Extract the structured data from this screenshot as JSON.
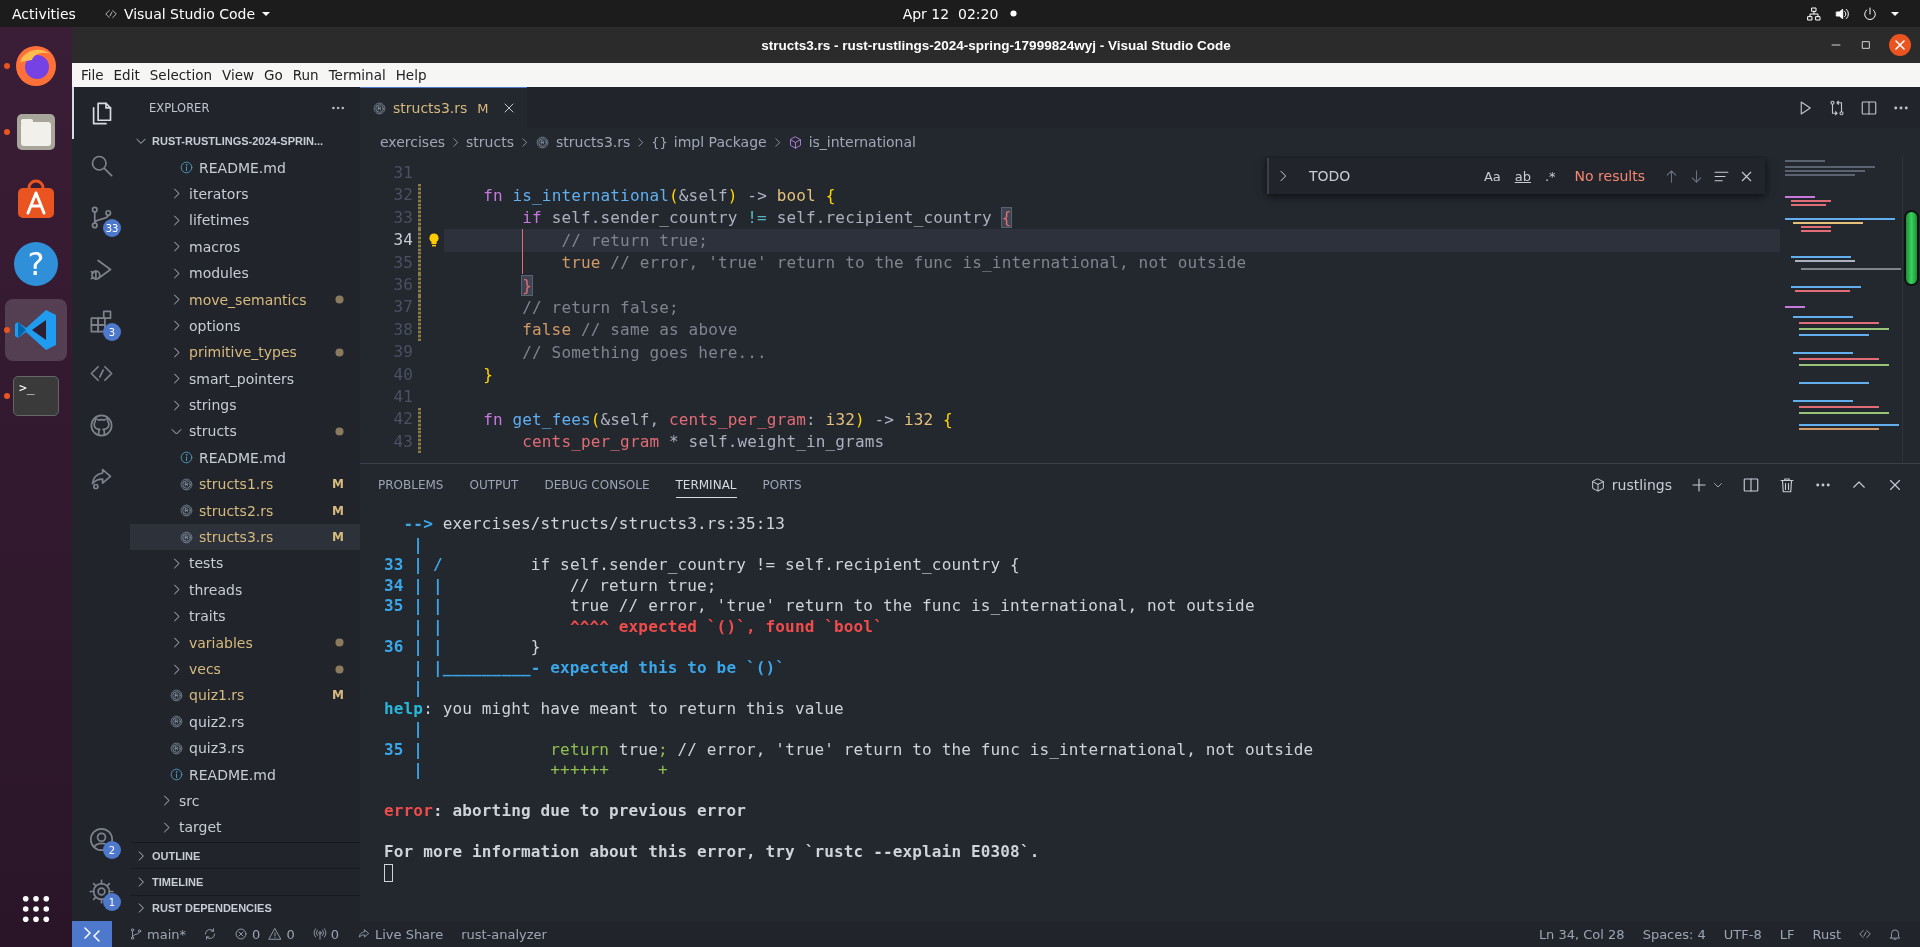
{
  "top_bar": {
    "activities": "Activities",
    "app_menu": "Visual Studio Code",
    "date": "Apr 12",
    "time": "02:20"
  },
  "dock": [
    {
      "kind": "firefox",
      "running": true,
      "selected": false
    },
    {
      "kind": "files",
      "running": true,
      "selected": false
    },
    {
      "kind": "software",
      "running": false,
      "selected": false
    },
    {
      "kind": "help",
      "running": false,
      "selected": false,
      "glyph": "?"
    },
    {
      "kind": "vscode",
      "running": true,
      "selected": true
    },
    {
      "kind": "terminal",
      "running": true,
      "selected": false,
      "glyph": ">_"
    }
  ],
  "window": {
    "title": "structs3.rs - rust-rustlings-2024-spring-17999824wyj - Visual Studio Code"
  },
  "menu": [
    "File",
    "Edit",
    "Selection",
    "View",
    "Go",
    "Run",
    "Terminal",
    "Help"
  ],
  "activity_bar": [
    {
      "kind": "explorer",
      "selected": true
    },
    {
      "kind": "search",
      "selected": false
    },
    {
      "kind": "source-control",
      "selected": false,
      "badge": "33"
    },
    {
      "kind": "run-debug",
      "selected": false
    },
    {
      "kind": "extensions",
      "selected": false,
      "badge": "3"
    },
    {
      "kind": "remote",
      "selected": false
    },
    {
      "kind": "github",
      "selected": false
    },
    {
      "kind": "live-share",
      "selected": false
    }
  ],
  "activity_bar_bottom": [
    {
      "kind": "account",
      "badge": "2"
    },
    {
      "kind": "settings",
      "badge": "1"
    }
  ],
  "sidebar": {
    "title": "EXPLORER",
    "folder": {
      "name": "RUST-RUSTLINGS-2024-SPRIN...",
      "expanded": true
    },
    "tree": [
      {
        "children": [
          {
            "children": [
              {
                "name": "README.md",
                "kind": "markdown",
                "selected": false,
                "changed": false
              }
            ]
          },
          {
            "name": "iterators",
            "kind": "folder",
            "expanded": false,
            "selected": false,
            "changed": false
          },
          {
            "name": "lifetimes",
            "kind": "folder",
            "expanded": false,
            "selected": false,
            "changed": false
          },
          {
            "name": "macros",
            "kind": "folder",
            "expanded": false,
            "selected": false,
            "changed": false
          },
          {
            "name": "modules",
            "kind": "folder",
            "expanded": false,
            "selected": false,
            "changed": false
          },
          {
            "name": "move_semantics",
            "kind": "folder",
            "expanded": false,
            "selected": false,
            "changed": true
          },
          {
            "name": "options",
            "kind": "folder",
            "expanded": false,
            "selected": false,
            "changed": false
          },
          {
            "name": "primitive_types",
            "kind": "folder",
            "expanded": false,
            "selected": false,
            "changed": true
          },
          {
            "name": "smart_pointers",
            "kind": "folder",
            "expanded": false,
            "selected": false,
            "changed": false
          },
          {
            "name": "strings",
            "kind": "folder",
            "expanded": false,
            "selected": false,
            "changed": false
          },
          {
            "name": "structs",
            "kind": "folder",
            "expanded": true,
            "selected": false,
            "changed": true,
            "children": [
              {
                "name": "README.md",
                "kind": "markdown",
                "selected": false,
                "changed": false
              },
              {
                "name": "structs1.rs",
                "kind": "rust",
                "selected": false,
                "changed": true,
                "badge": "M"
              },
              {
                "name": "structs2.rs",
                "kind": "rust",
                "selected": false,
                "changed": true,
                "badge": "M"
              },
              {
                "name": "structs3.rs",
                "kind": "rust",
                "selected": true,
                "changed": true,
                "badge": "M"
              }
            ]
          },
          {
            "name": "tests",
            "kind": "folder",
            "expanded": false,
            "selected": false,
            "changed": false
          },
          {
            "name": "threads",
            "kind": "folder",
            "expanded": false,
            "selected": false,
            "changed": false
          },
          {
            "name": "traits",
            "kind": "folder",
            "expanded": false,
            "selected": false,
            "changed": false
          },
          {
            "name": "variables",
            "kind": "folder",
            "expanded": false,
            "selected": false,
            "changed": true
          },
          {
            "name": "vecs",
            "kind": "folder",
            "expanded": false,
            "selected": false,
            "changed": true
          },
          {
            "name": "quiz1.rs",
            "kind": "rust",
            "selected": false,
            "changed": true,
            "badge": "M"
          },
          {
            "name": "quiz2.rs",
            "kind": "rust",
            "selected": false,
            "changed": false
          },
          {
            "name": "quiz3.rs",
            "kind": "rust",
            "selected": false,
            "changed": false
          },
          {
            "name": "README.md",
            "kind": "markdown",
            "selected": false,
            "changed": false
          }
        ]
      },
      {
        "name": "src",
        "kind": "folder",
        "expanded": false,
        "selected": false,
        "changed": false
      },
      {
        "name": "target",
        "kind": "folder",
        "expanded": false,
        "selected": false,
        "changed": false
      }
    ],
    "sections": [
      {
        "name": "OUTLINE",
        "expanded": false
      },
      {
        "name": "TIMELINE",
        "expanded": false
      },
      {
        "name": "RUST DEPENDENCIES",
        "expanded": false
      }
    ]
  },
  "editor_tabs": [
    {
      "label": "structs3.rs",
      "kind": "rust",
      "selected": true,
      "changed": true,
      "badge": "M"
    }
  ],
  "breadcrumbs": [
    {
      "label": "exercises"
    },
    {
      "label": "structs"
    },
    {
      "label": "structs3.rs",
      "kind": "rust"
    },
    {
      "label": "impl Package",
      "kind": "namespace",
      "symbol": "{}"
    },
    {
      "label": "is_international",
      "kind": "method"
    }
  ],
  "find_widget": {
    "value": "TODO",
    "expanded": false,
    "options": [
      {
        "label": "Aa",
        "on": false
      },
      {
        "label": "ab",
        "on": false
      },
      {
        "label": ".*",
        "on": false
      }
    ],
    "result": "No results"
  },
  "code": [
    {
      "number": "31",
      "current": false,
      "modified": false
    },
    {
      "number": "32",
      "current": false,
      "modified": true,
      "tokens": [
        {
          "kind": "kw",
          "text": "    fn "
        },
        {
          "kind": "fn",
          "text": "is_international"
        },
        {
          "kind": "br1",
          "text": "("
        },
        {
          "kind": "plain",
          "text": "&self"
        },
        {
          "kind": "br1",
          "text": ")"
        },
        {
          "kind": "plain",
          "text": " -> "
        },
        {
          "kind": "type",
          "text": "bool "
        },
        {
          "kind": "br1",
          "text": "{"
        }
      ]
    },
    {
      "number": "33",
      "current": false,
      "modified": true,
      "tokens": [
        {
          "kind": "kw",
          "text": "        if"
        },
        {
          "kind": "plain",
          "text": " self.sender_country "
        },
        {
          "kind": "op",
          "text": "!="
        },
        {
          "kind": "plain",
          "text": " self.recipient_country "
        },
        {
          "kind": "brm",
          "text": "{"
        }
      ]
    },
    {
      "number": "34",
      "current": true,
      "modified": true,
      "error": true,
      "lightbulb": true,
      "tokens": [
        {
          "kind": "cmt",
          "text": "            // return true;"
        }
      ]
    },
    {
      "number": "35",
      "current": false,
      "modified": true,
      "error": true,
      "tokens": [
        {
          "kind": "lit",
          "text": "            true"
        },
        {
          "kind": "cmt",
          "text": " // error, 'true' return to the func is_international, not outside"
        }
      ]
    },
    {
      "number": "36",
      "current": false,
      "modified": true,
      "tokens": [
        {
          "kind": "brm",
          "text": "        }"
        }
      ]
    },
    {
      "number": "37",
      "current": false,
      "modified": true,
      "tokens": [
        {
          "kind": "cmt",
          "text": "        // return false;"
        }
      ]
    },
    {
      "number": "38",
      "current": false,
      "modified": true,
      "tokens": [
        {
          "kind": "lit",
          "text": "        false"
        },
        {
          "kind": "cmt",
          "text": " // same as above"
        }
      ]
    },
    {
      "number": "39",
      "current": false,
      "modified": false,
      "tokens": [
        {
          "kind": "cmt",
          "text": "        // Something goes here..."
        }
      ]
    },
    {
      "number": "40",
      "current": false,
      "modified": false,
      "tokens": [
        {
          "kind": "br1",
          "text": "    }"
        }
      ]
    },
    {
      "number": "41",
      "current": false,
      "modified": false
    },
    {
      "number": "42",
      "current": false,
      "modified": true,
      "tokens": [
        {
          "kind": "kw",
          "text": "    fn "
        },
        {
          "kind": "fn",
          "text": "get_fees"
        },
        {
          "kind": "br1",
          "text": "("
        },
        {
          "kind": "plain",
          "text": "&self, "
        },
        {
          "kind": "param",
          "text": "cents_per_gram"
        },
        {
          "kind": "plain",
          "text": ": "
        },
        {
          "kind": "type",
          "text": "i32"
        },
        {
          "kind": "br1",
          "text": ")"
        },
        {
          "kind": "plain",
          "text": " -> "
        },
        {
          "kind": "type",
          "text": "i32 "
        },
        {
          "kind": "br1",
          "text": "{"
        }
      ]
    },
    {
      "number": "43",
      "current": false,
      "modified": true,
      "tokens": [
        {
          "kind": "param",
          "text": "        cents_per_gram"
        },
        {
          "kind": "plain",
          "text": " * self.weight_in_grams"
        }
      ]
    }
  ],
  "panel": {
    "tabs": [
      {
        "label": "PROBLEMS",
        "selected": false
      },
      {
        "label": "OUTPUT",
        "selected": false
      },
      {
        "label": "DEBUG CONSOLE",
        "selected": false
      },
      {
        "label": "TERMINAL",
        "selected": true
      },
      {
        "label": "PORTS",
        "selected": false
      }
    ],
    "terminal_name": "rustlings",
    "terminal": [
      {
        "kind": "text",
        "segments": [
          {
            "kind": "gutter",
            "text": "  --> "
          },
          {
            "kind": "plain",
            "text": "exercises/structs/structs3.rs:35:13"
          }
        ]
      },
      {
        "kind": "text",
        "segments": [
          {
            "kind": "gutter",
            "text": "   |"
          }
        ]
      },
      {
        "kind": "text",
        "segments": [
          {
            "kind": "gutter",
            "text": "33 | /"
          },
          {
            "kind": "plain",
            "text": "         if self.sender_country != self.recipient_country {"
          }
        ]
      },
      {
        "kind": "text",
        "segments": [
          {
            "kind": "gutter",
            "text": "34 | |"
          },
          {
            "kind": "plain",
            "text": "             // return true;"
          }
        ]
      },
      {
        "kind": "text",
        "segments": [
          {
            "kind": "gutter",
            "text": "35 | |"
          },
          {
            "kind": "plain",
            "text": "             true // error, 'true' return to the func is_international, not outside"
          }
        ]
      },
      {
        "kind": "text",
        "segments": [
          {
            "kind": "gutter",
            "text": "   | |"
          },
          {
            "kind": "error",
            "text": "             ^^^^ expected `()`, found `bool`"
          }
        ]
      },
      {
        "kind": "text",
        "segments": [
          {
            "kind": "gutter",
            "text": "36 | |"
          },
          {
            "kind": "plain",
            "text": "         }"
          }
        ]
      },
      {
        "kind": "text",
        "segments": [
          {
            "kind": "gutter",
            "text": "   | |_________- expected this to be `()`"
          }
        ]
      },
      {
        "kind": "text",
        "segments": [
          {
            "kind": "gutter",
            "text": "   |"
          }
        ]
      },
      {
        "kind": "text",
        "segments": [
          {
            "kind": "help",
            "text": "help"
          },
          {
            "kind": "plain",
            "text": ": you might have meant to return this value"
          }
        ]
      },
      {
        "kind": "text",
        "segments": [
          {
            "kind": "gutter",
            "text": "   |"
          }
        ]
      },
      {
        "kind": "text",
        "segments": [
          {
            "kind": "gutter",
            "text": "35 |"
          },
          {
            "kind": "add",
            "text": "             return"
          },
          {
            "kind": "plain",
            "text": " true"
          },
          {
            "kind": "add",
            "text": ";"
          },
          {
            "kind": "plain",
            "text": " // error, 'true' return to the func is_international, not outside"
          }
        ]
      },
      {
        "kind": "text",
        "segments": [
          {
            "kind": "gutter",
            "text": "   |"
          },
          {
            "kind": "add",
            "text": "             ++++++     +"
          }
        ]
      },
      {
        "kind": "blank"
      },
      {
        "kind": "text",
        "segments": [
          {
            "kind": "error",
            "text": "error"
          },
          {
            "kind": "bold",
            "text": ": aborting due to previous error"
          }
        ]
      },
      {
        "kind": "blank"
      },
      {
        "kind": "text",
        "segments": [
          {
            "kind": "bold",
            "text": "For more information about this error, try `rustc --explain E0308`."
          }
        ]
      },
      {
        "kind": "cursor"
      }
    ]
  },
  "status_bar": {
    "branch": "main*",
    "errors": "0",
    "warnings": "0",
    "ports": "0",
    "live_share": "Live Share",
    "language_server": "rust-analyzer",
    "right": [
      "Ln 34, Col 28",
      "Spaces: 4",
      "UTF-8",
      "LF",
      "Rust"
    ]
  }
}
